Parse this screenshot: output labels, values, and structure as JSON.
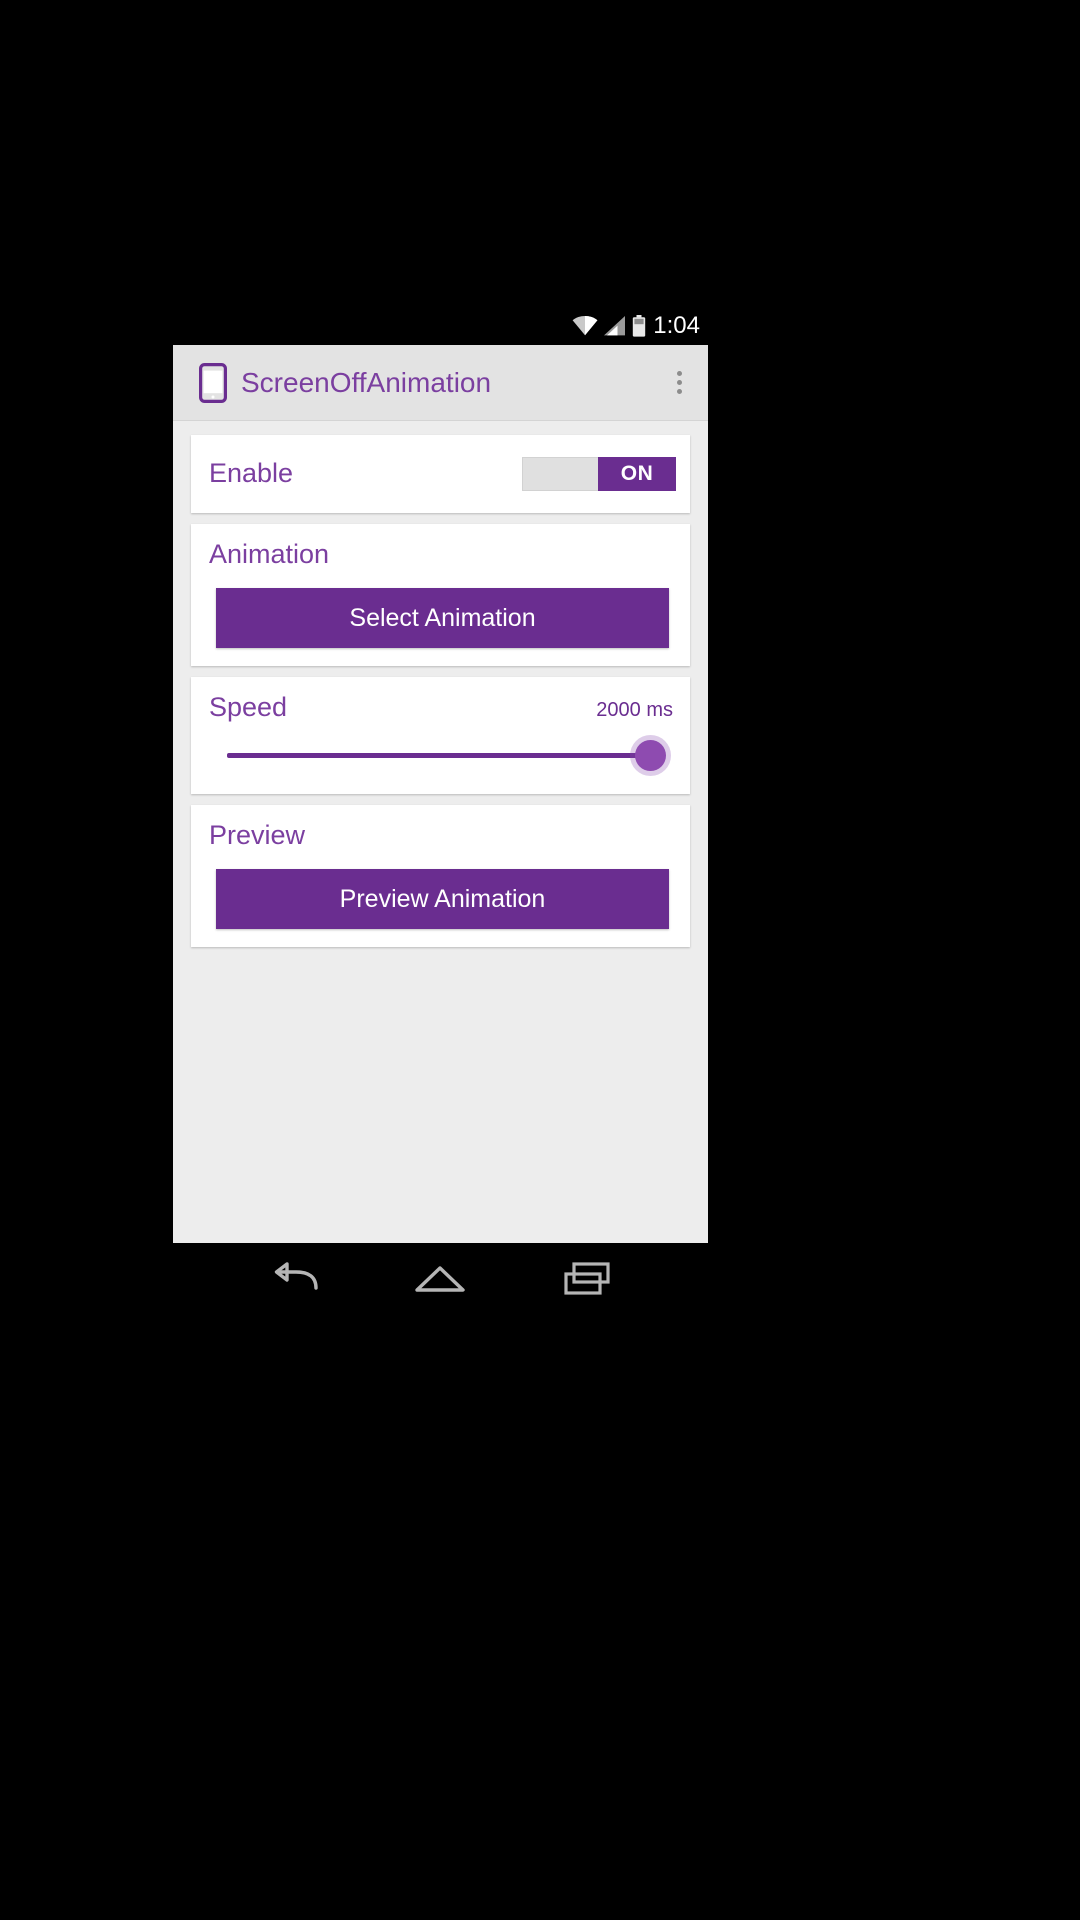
{
  "status_bar": {
    "time": "1:04",
    "icons": [
      "wifi-icon",
      "signal-icon",
      "battery-icon"
    ]
  },
  "app_bar": {
    "title": "ScreenOffAnimation",
    "app_icon": "phone-icon",
    "overflow_icon": "overflow-menu-icon"
  },
  "cards": {
    "enable": {
      "title": "Enable",
      "switch_state_label": "ON"
    },
    "animation": {
      "title": "Animation",
      "button_label": "Select Animation"
    },
    "speed": {
      "title": "Speed",
      "value_label": "2000 ms"
    },
    "preview": {
      "title": "Preview",
      "button_label": "Preview Animation"
    }
  },
  "nav_bar": {
    "back_icon": "back-arrow-icon",
    "home_icon": "home-icon",
    "recents_icon": "recents-icon"
  },
  "colors": {
    "accent_purple": "#6a2d90",
    "title_purple": "#7b3fa0",
    "card_background": "#ffffff",
    "content_background": "#ededed",
    "app_bar_background": "#e3e3e3"
  }
}
